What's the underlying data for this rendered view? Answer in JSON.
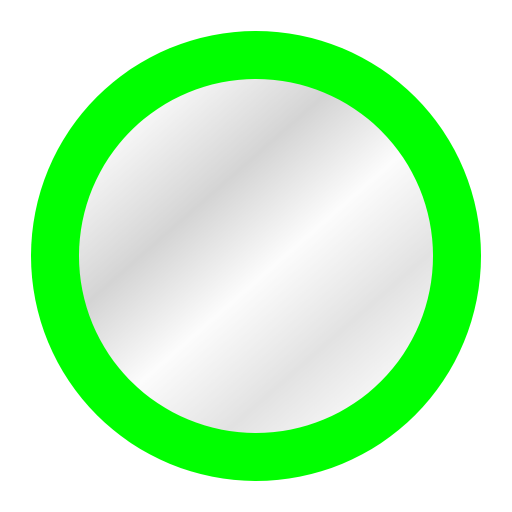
{
  "icon": {
    "name": "circle-ring-icon",
    "ring_color": "#00ff00",
    "inner_fill": "gradient-silver",
    "gradient_colors": [
      "#fafafa",
      "#d4d4d4",
      "#fcfcfc",
      "#e2e2e2",
      "#f7f7f7"
    ],
    "background_color": "#ffffff"
  }
}
